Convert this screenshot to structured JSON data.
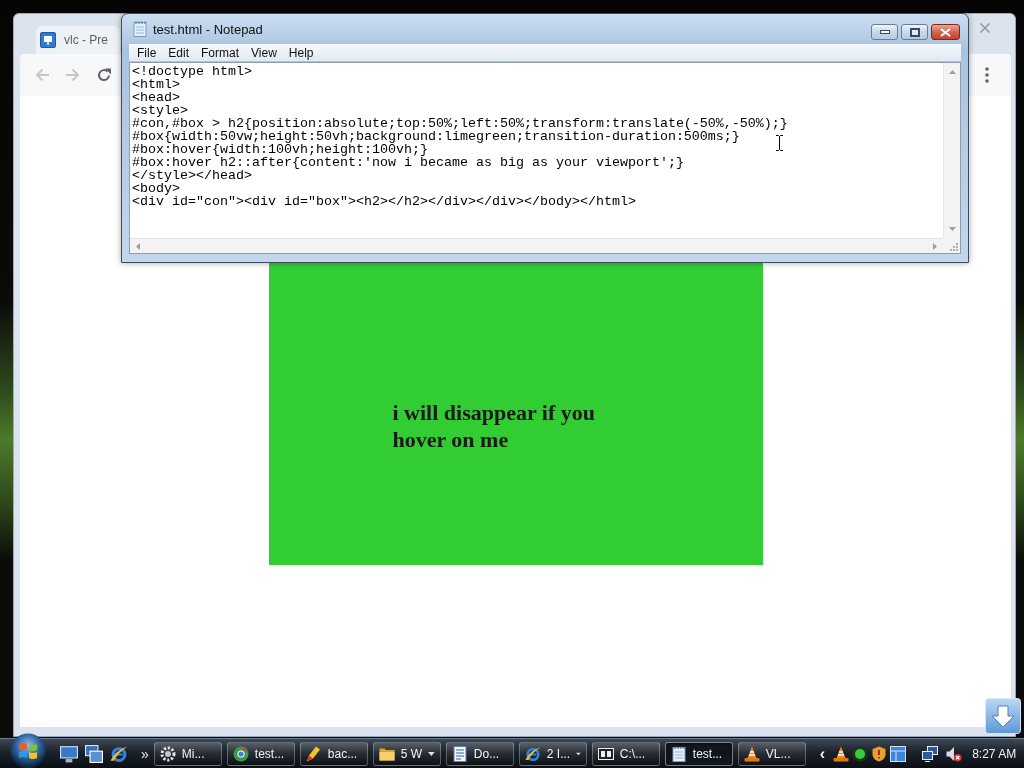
{
  "browser": {
    "tab_title": "vlc - Pre",
    "page_heading": "i will disappear if you hover on me"
  },
  "notepad": {
    "title": "test.html - Notepad",
    "menu": [
      "File",
      "Edit",
      "Format",
      "View",
      "Help"
    ],
    "lines": [
      "<!doctype html>",
      "<html>",
      "<head>",
      "<style>",
      "#con,#box > h2{position:absolute;top:50%;left:50%;transform:translate(-50%,-50%);}",
      "#box{width:50vw;height:50vh;background:limegreen;transition-duration:500ms;}",
      "#box:hover{width:100vh;height:100vh;}",
      "#box:hover h2::after{content:'now i became as big as your viewport';}",
      "</style></head>",
      "<body>",
      "<div id=\"con\"><div id=\"box\"><h2></h2></div></div></body></html>"
    ]
  },
  "taskbar": {
    "quick_launch_more": "»",
    "buttons": [
      {
        "label": "Mi...",
        "selected": false,
        "grouped": false
      },
      {
        "label": "test...",
        "selected": false,
        "grouped": false
      },
      {
        "label": "bac...",
        "selected": false,
        "grouped": false
      },
      {
        "label": "5 W",
        "selected": false,
        "grouped": true
      },
      {
        "label": "Do...",
        "selected": false,
        "grouped": false
      },
      {
        "label": "2 I...",
        "selected": false,
        "grouped": true
      },
      {
        "label": "C:\\...",
        "selected": false,
        "grouped": false
      },
      {
        "label": "test...",
        "selected": true,
        "grouped": false
      },
      {
        "label": "VL...",
        "selected": false,
        "grouped": false
      }
    ],
    "tray_more": "‹",
    "clock": "8:27 AM"
  }
}
